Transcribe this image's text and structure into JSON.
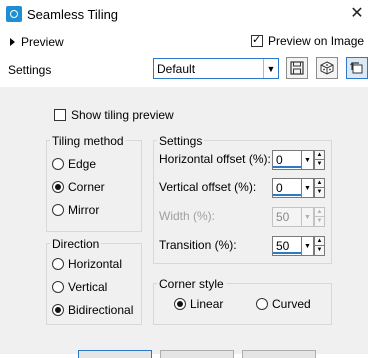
{
  "window": {
    "title": "Seamless Tiling",
    "close_glyph": "✕"
  },
  "preview": {
    "label": "Preview",
    "preview_on_image_label": "Preview on Image",
    "preview_on_image_checked": true
  },
  "settings_row": {
    "label": "Settings",
    "preset_value": "Default"
  },
  "show_tiling_preview": {
    "label": "Show tiling preview",
    "checked": false
  },
  "tiling_method": {
    "title": "Tiling method",
    "options": [
      {
        "label": "Edge",
        "selected": false
      },
      {
        "label": "Corner",
        "selected": true
      },
      {
        "label": "Mirror",
        "selected": false
      }
    ]
  },
  "direction": {
    "title": "Direction",
    "options": [
      {
        "label": "Horizontal",
        "selected": false
      },
      {
        "label": "Vertical",
        "selected": false
      },
      {
        "label": "Bidirectional",
        "selected": true
      }
    ]
  },
  "settings_group": {
    "title": "Settings",
    "fields": [
      {
        "label": "Horizontal offset (%):",
        "value": "0",
        "enabled": true
      },
      {
        "label": "Vertical offset (%):",
        "value": "0",
        "enabled": true
      },
      {
        "label": "Width (%):",
        "value": "50",
        "enabled": false
      },
      {
        "label": "Transition (%):",
        "value": "50",
        "enabled": true
      }
    ]
  },
  "corner_style": {
    "title": "Corner style",
    "options": [
      {
        "label": "Linear",
        "selected": true
      },
      {
        "label": "Curved",
        "selected": false
      }
    ]
  },
  "colors": {
    "accent": "#2b79c8",
    "panel_bg": "#f0f0f0",
    "disabled_text": "#a0a0a0"
  }
}
